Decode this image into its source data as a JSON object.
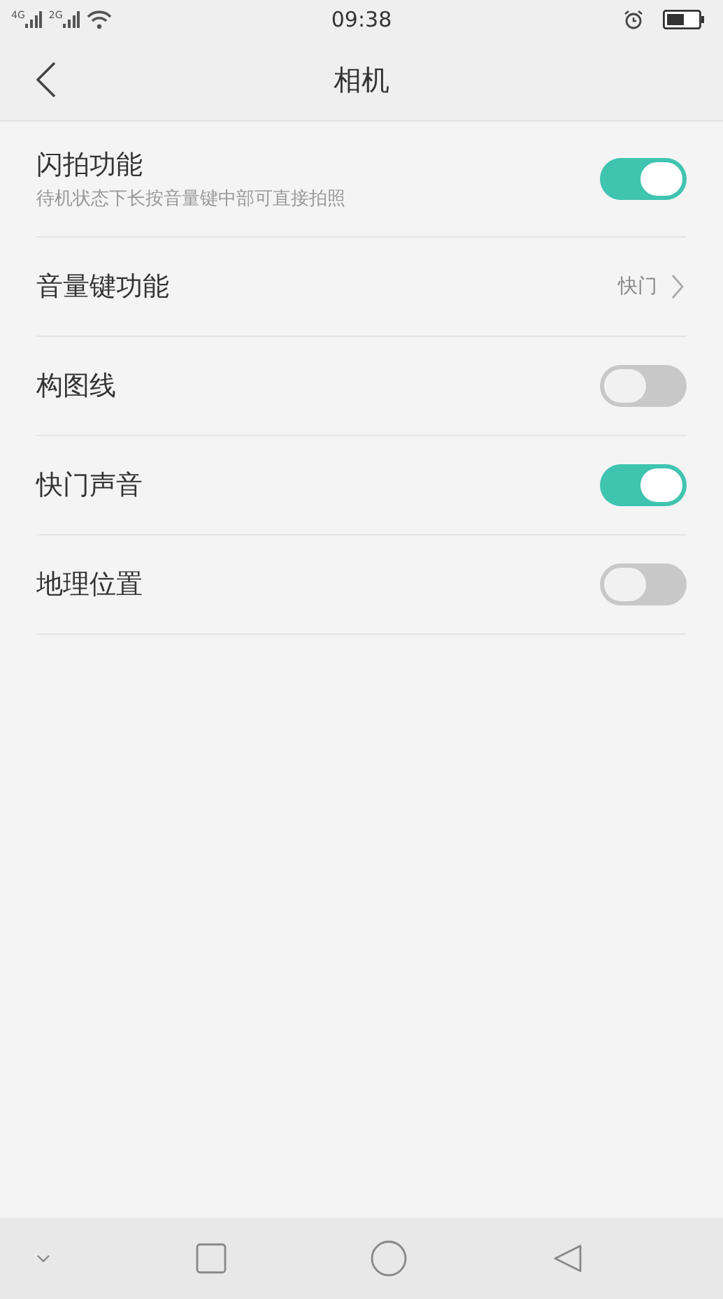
{
  "status_bar": {
    "networks": [
      "4G",
      "2G"
    ],
    "time": "09:38"
  },
  "header": {
    "title": "相机"
  },
  "settings": [
    {
      "kind": "toggle",
      "label": "闪拍功能",
      "description": "待机状态下长按音量键中部可直接拍照",
      "on": true
    },
    {
      "kind": "link",
      "label": "音量键功能",
      "value": "快门"
    },
    {
      "kind": "toggle",
      "label": "构图线",
      "on": false
    },
    {
      "kind": "toggle",
      "label": "快门声音",
      "on": true
    },
    {
      "kind": "toggle",
      "label": "地理位置",
      "on": false
    }
  ]
}
